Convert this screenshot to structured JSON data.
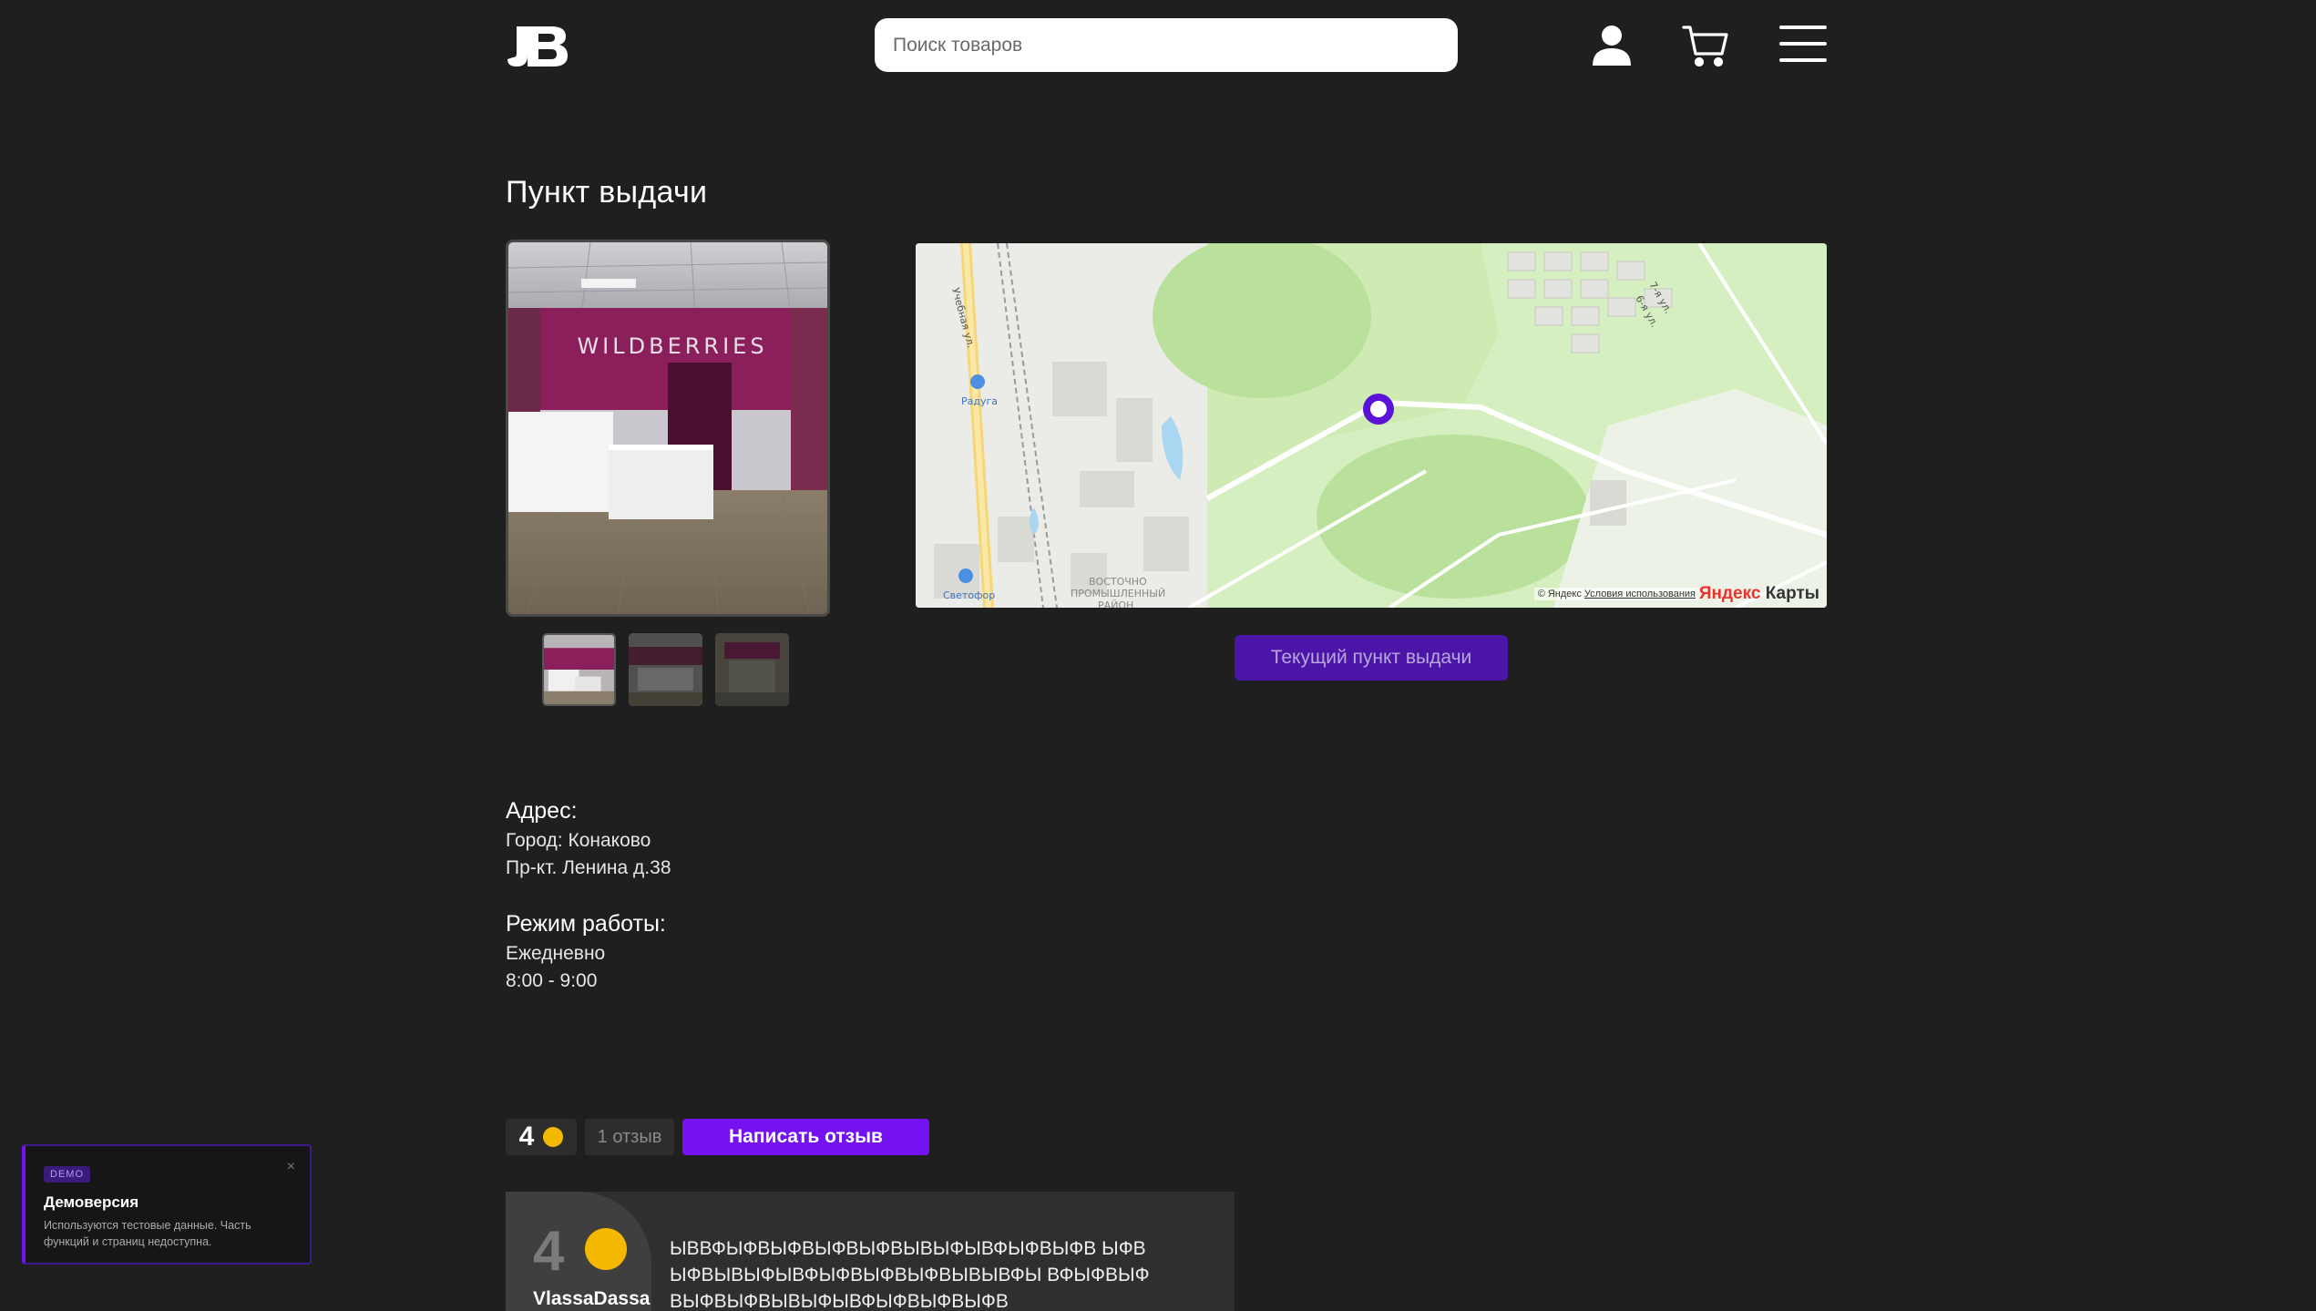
{
  "header": {
    "logo_icon": "jb-logo-icon",
    "search_placeholder": "Поиск товаров",
    "icons": [
      "user-icon",
      "cart-icon",
      "menu-icon"
    ]
  },
  "page": {
    "title": "Пункт выдачи"
  },
  "gallery": {
    "sign_text": "WILDBERRIES",
    "thumbnails": 3,
    "active_thumbnail": 1
  },
  "map": {
    "labels": {
      "street": "Учебная ул.",
      "raduga": "Радуга",
      "svetofor": "Светофор",
      "district_1": "ВОСТОЧНО",
      "district_2": "ПРОМЫШЛЕННЫЙ",
      "district_3": "РАЙОН",
      "street_7": "7-я ул.",
      "street_6": "6-я ул."
    },
    "copyright": "© Яндекс",
    "terms_link": "Условия использования",
    "brand_ya": "Яндекс",
    "brand_maps": " Карты"
  },
  "pickup": {
    "button_label": "Текущий пункт выдачи"
  },
  "address": {
    "heading": "Адрес:",
    "city": "Город: Конаково",
    "street": "Пр-кт. Ленина д.38"
  },
  "schedule": {
    "heading": "Режим работы:",
    "days": "Ежедневно",
    "hours": "8:00 - 9:00"
  },
  "rating": {
    "score": "4",
    "reviews_count": "1 отзыв",
    "write_button": "Написать отзыв"
  },
  "review": {
    "score": "4",
    "user": "VlassaDassa",
    "text": "ЫВВФЫФВЫФВЫФВЫФВЫВЫФЫВФЫФВЫФВ ЫФВЫФВЫВЫФЫВФЫФВЫФВЫФВЫВЫВФЫ ВФЫФВЫФВЫФВЫФВЫВЫФЫВФЫФВЫФВЫФВ"
  },
  "toast": {
    "badge": "DEMO",
    "close": "×",
    "title": "Демоверсия",
    "body": "Используются тестовые данные. Часть функций и страниц недоступна."
  },
  "colors": {
    "background": "#1f1f1f",
    "accent": "#7412f1",
    "accent_dark": "#4b16a8",
    "rating_dot": "#f5b800"
  }
}
